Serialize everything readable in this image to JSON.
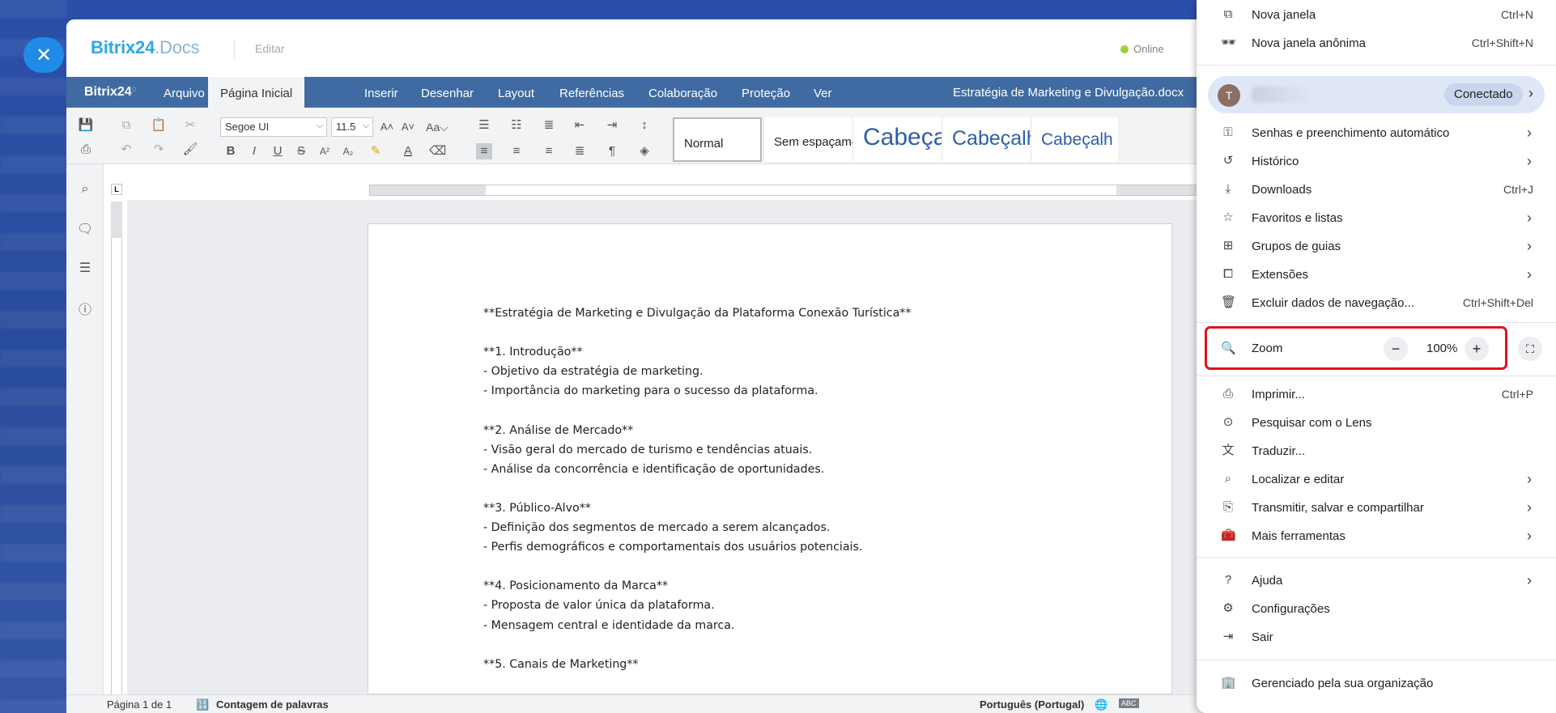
{
  "app": {
    "logo_brand": "Bitrix24",
    "logo_suffix": ".Docs",
    "edit_label": "Editar",
    "online_label": "Online",
    "menubar_brand": "Bitrix24",
    "tabs": [
      "Arquivo",
      "Página Inicial",
      "Inserir",
      "Desenhar",
      "Layout",
      "Referências",
      "Colaboração",
      "Proteção",
      "Ver"
    ],
    "active_tab": "Página Inicial",
    "doc_title": "Estratégia de Marketing e Divulgação.docx"
  },
  "toolbar": {
    "font": "Segoe UI",
    "size": "11.5",
    "styles": [
      "Normal",
      "Sem espaçame",
      "Cabeça",
      "Cabeçalh",
      "Cabeçalh"
    ]
  },
  "document": {
    "lines": [
      "**Estratégia de Marketing e Divulgação da Plataforma Conexão Turística**",
      "",
      "**1. Introdução**",
      "- Objetivo da estratégia de marketing.",
      "- Importância do marketing para o sucesso da plataforma.",
      "",
      "**2. Análise de Mercado**",
      "- Visão geral do mercado de turismo e tendências atuais.",
      "- Análise da concorrência e identificação de oportunidades.",
      "",
      "**3. Público-Alvo**",
      "- Definição dos segmentos de mercado a serem alcançados.",
      "- Perfis demográficos e comportamentais dos usuários potenciais.",
      "",
      "**4. Posicionamento da Marca**",
      "- Proposta de valor única da plataforma.",
      "- Mensagem central e identidade da marca.",
      "",
      "**5. Canais de Marketing**"
    ]
  },
  "statusbar": {
    "page": "Página 1 de 1",
    "word_count": "Contagem de palavras",
    "language": "Português (Portugal)"
  },
  "chrome_menu": {
    "new_window": {
      "label": "Nova janela",
      "shortcut": "Ctrl+N"
    },
    "incognito": {
      "label": "Nova janela anônima",
      "shortcut": "Ctrl+Shift+N"
    },
    "profile": {
      "avatar_letter": "T",
      "status": "Conectado"
    },
    "passwords": {
      "label": "Senhas e preenchimento automático"
    },
    "history": {
      "label": "Histórico"
    },
    "downloads": {
      "label": "Downloads",
      "shortcut": "Ctrl+J"
    },
    "bookmarks": {
      "label": "Favoritos e listas"
    },
    "tab_groups": {
      "label": "Grupos de guias"
    },
    "extensions": {
      "label": "Extensões"
    },
    "clear_data": {
      "label": "Excluir dados de navegação...",
      "shortcut": "Ctrl+Shift+Del"
    },
    "zoom": {
      "label": "Zoom",
      "value": "100%",
      "minus": "−",
      "plus": "+"
    },
    "print": {
      "label": "Imprimir...",
      "shortcut": "Ctrl+P"
    },
    "lens": {
      "label": "Pesquisar com o Lens"
    },
    "translate": {
      "label": "Traduzir..."
    },
    "find_edit": {
      "label": "Localizar e editar"
    },
    "cast_save": {
      "label": "Transmitir, salvar e compartilhar"
    },
    "more_tools": {
      "label": "Mais ferramentas"
    },
    "help": {
      "label": "Ajuda"
    },
    "settings": {
      "label": "Configurações"
    },
    "exit": {
      "label": "Sair"
    },
    "managed": {
      "label": "Gerenciado pela sua organização"
    }
  },
  "colors": {
    "accent": "#3f6ba2",
    "zoom_highlight": "#e3101b",
    "online": "#9ed134"
  }
}
